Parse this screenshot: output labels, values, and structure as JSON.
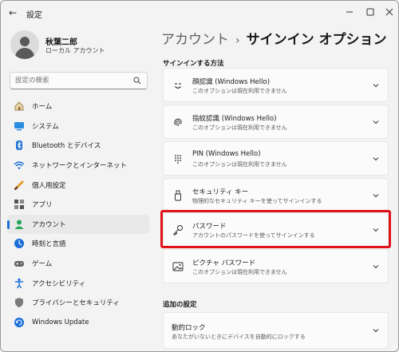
{
  "window": {
    "title": "設定",
    "back_icon": "back-arrow-icon"
  },
  "user": {
    "name": "秋葉二郎",
    "account_type": "ローカル アカウント"
  },
  "search": {
    "placeholder": "設定の検索"
  },
  "nav": {
    "items": [
      {
        "label": "ホーム",
        "icon": "home-icon"
      },
      {
        "label": "システム",
        "icon": "system-icon"
      },
      {
        "label": "Bluetooth とデバイス",
        "icon": "bluetooth-icon"
      },
      {
        "label": "ネットワークとインターネット",
        "icon": "network-icon"
      },
      {
        "label": "個人用設定",
        "icon": "brush-icon"
      },
      {
        "label": "アプリ",
        "icon": "apps-icon"
      },
      {
        "label": "アカウント",
        "icon": "account-icon",
        "active": true
      },
      {
        "label": "時刻と言語",
        "icon": "time-language-icon"
      },
      {
        "label": "ゲーム",
        "icon": "game-icon"
      },
      {
        "label": "アクセシビリティ",
        "icon": "accessibility-icon"
      },
      {
        "label": "プライバシーとセキュリティ",
        "icon": "shield-icon"
      },
      {
        "label": "Windows Update",
        "icon": "update-icon"
      }
    ]
  },
  "breadcrumb": {
    "parent": "アカウント",
    "separator": "›",
    "current": "サインイン オプション"
  },
  "signin_section": {
    "heading": "サインインする方法"
  },
  "options": [
    {
      "title": "顔認識 (Windows Hello)",
      "subtitle": "このオプションは現在利用できません",
      "icon": "face-icon"
    },
    {
      "title": "指紋認識 (Windows Hello)",
      "subtitle": "このオプションは現在利用できません",
      "icon": "fingerprint-icon"
    },
    {
      "title": "PIN (Windows Hello)",
      "subtitle": "このオプションは現在利用できません",
      "icon": "pin-keypad-icon"
    },
    {
      "title": "セキュリティ キー",
      "subtitle": "物理的なセキュリティ キーを使ってサインインする",
      "icon": "usb-key-icon"
    },
    {
      "title": "パスワード",
      "subtitle": "アカウントのパスワードを使ってサインインする",
      "icon": "key-icon",
      "highlighted": true
    },
    {
      "title": "ピクチャ パスワード",
      "subtitle": "このオプションは現在利用できません",
      "icon": "picture-icon"
    }
  ],
  "additional_section": {
    "heading": "追加の設定"
  },
  "additional_options": [
    {
      "title": "動的ロック",
      "subtitle": "あなたがいないときにデバイスを自動的にロックする"
    }
  ],
  "colors": {
    "accent": "#1a6ed8",
    "highlight": "#e0121a"
  }
}
